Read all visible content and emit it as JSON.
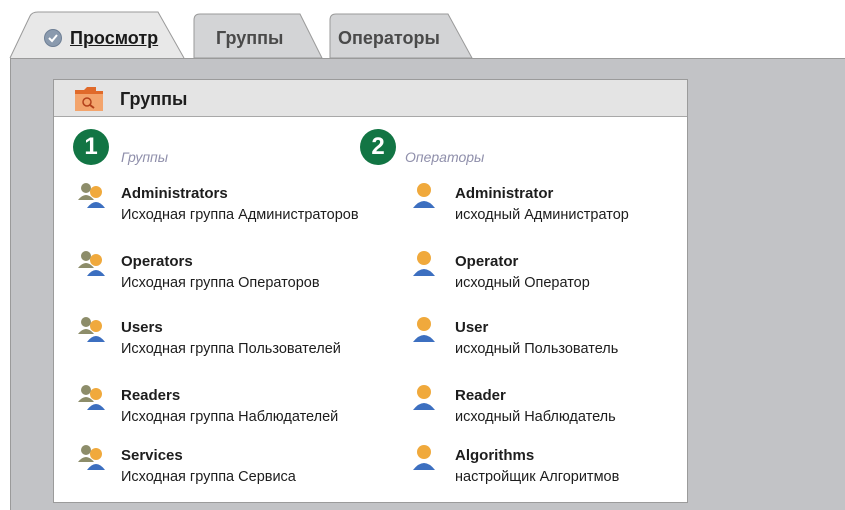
{
  "tabs": [
    {
      "label": "Просмотр",
      "active": true
    },
    {
      "label": "Группы",
      "active": false
    },
    {
      "label": "Операторы",
      "active": false
    }
  ],
  "panel": {
    "title": "Группы",
    "columns": [
      {
        "number": "1",
        "heading": "Группы"
      },
      {
        "number": "2",
        "heading": "Операторы"
      }
    ]
  },
  "groups": [
    {
      "name": "Administrators",
      "description": "Исходная группа Администраторов"
    },
    {
      "name": "Operators",
      "description": "Исходная группа Операторов"
    },
    {
      "name": "Users",
      "description": "Исходная группа Пользователей"
    },
    {
      "name": "Readers",
      "description": "Исходная группа Наблюдателей"
    },
    {
      "name": "Services",
      "description": "Исходная группа Сервиса"
    }
  ],
  "operators": [
    {
      "name": "Administrator",
      "description": "исходный Администратор"
    },
    {
      "name": "Operator",
      "description": "исходный Оператор"
    },
    {
      "name": "User",
      "description": "исходный Пользователь"
    },
    {
      "name": "Reader",
      "description": "исходный Наблюдатель"
    },
    {
      "name": "Algorithms",
      "description": "настройщик Алгоритмов"
    }
  ],
  "colors": {
    "badge": "#127544",
    "content_bg": "#c2c3c6",
    "tab_active": "#e8e8e8",
    "tab_inactive": "#d3d4d6"
  },
  "icons": {
    "check": "check-circle-icon",
    "folder": "folder-search-icon",
    "group": "user-group-icon",
    "user": "user-icon"
  }
}
